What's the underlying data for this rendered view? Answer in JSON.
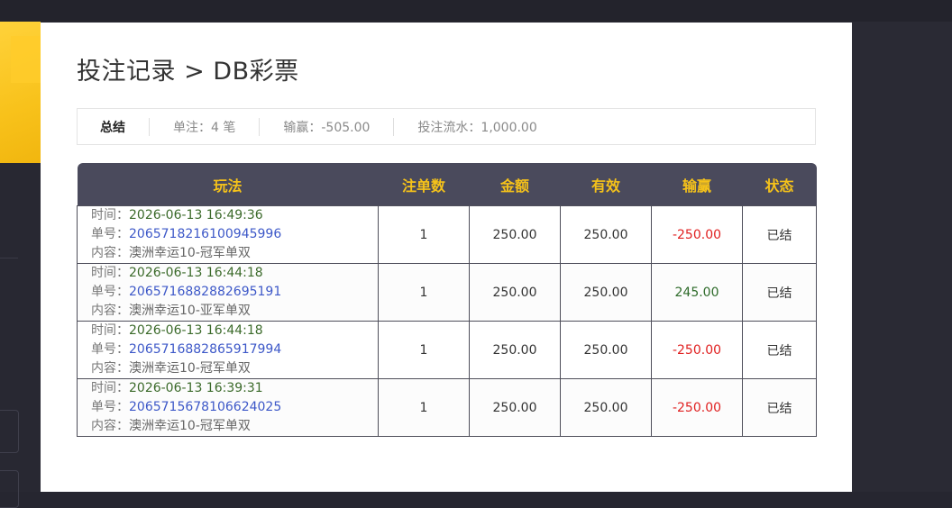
{
  "page": {
    "title": "投注记录 > DB彩票"
  },
  "summary": {
    "label": "总结",
    "bets": "单注：4 笔",
    "winloss": "输赢：-505.00",
    "turnover": "投注流水：1,000.00"
  },
  "table": {
    "headers": [
      "玩法",
      "注单数",
      "金额",
      "有效",
      "输赢",
      "状态"
    ],
    "time_label": "时间：",
    "order_label": "单号：",
    "content_label": "内容：",
    "rows": [
      {
        "time": "2026-06-13 16:49:36",
        "order": "2065718216100945996",
        "content": "澳洲幸运10-冠军单双",
        "count": "1",
        "amount": "250.00",
        "valid": "250.00",
        "winloss": "-250.00",
        "status": "已结"
      },
      {
        "time": "2026-06-13 16:44:18",
        "order": "2065716882882695191",
        "content": "澳洲幸运10-亚军单双",
        "count": "1",
        "amount": "250.00",
        "valid": "250.00",
        "winloss": "245.00",
        "status": "已结"
      },
      {
        "time": "2026-06-13 16:44:18",
        "order": "2065716882865917994",
        "content": "澳洲幸运10-冠军单双",
        "count": "1",
        "amount": "250.00",
        "valid": "250.00",
        "winloss": "-250.00",
        "status": "已结"
      },
      {
        "time": "2026-06-13 16:39:31",
        "order": "2065715678106624025",
        "content": "澳洲幸运10-冠军单双",
        "count": "1",
        "amount": "250.00",
        "valid": "250.00",
        "winloss": "-250.00",
        "status": "已结"
      }
    ]
  },
  "colors": {
    "header_bg": "#4a4a5c",
    "header_text": "#f5c21a",
    "loss": "#e02020",
    "win": "#2e6b2a",
    "order_link": "#3d58c8",
    "backdrop": "#282832",
    "banner": "#f8c21b"
  }
}
